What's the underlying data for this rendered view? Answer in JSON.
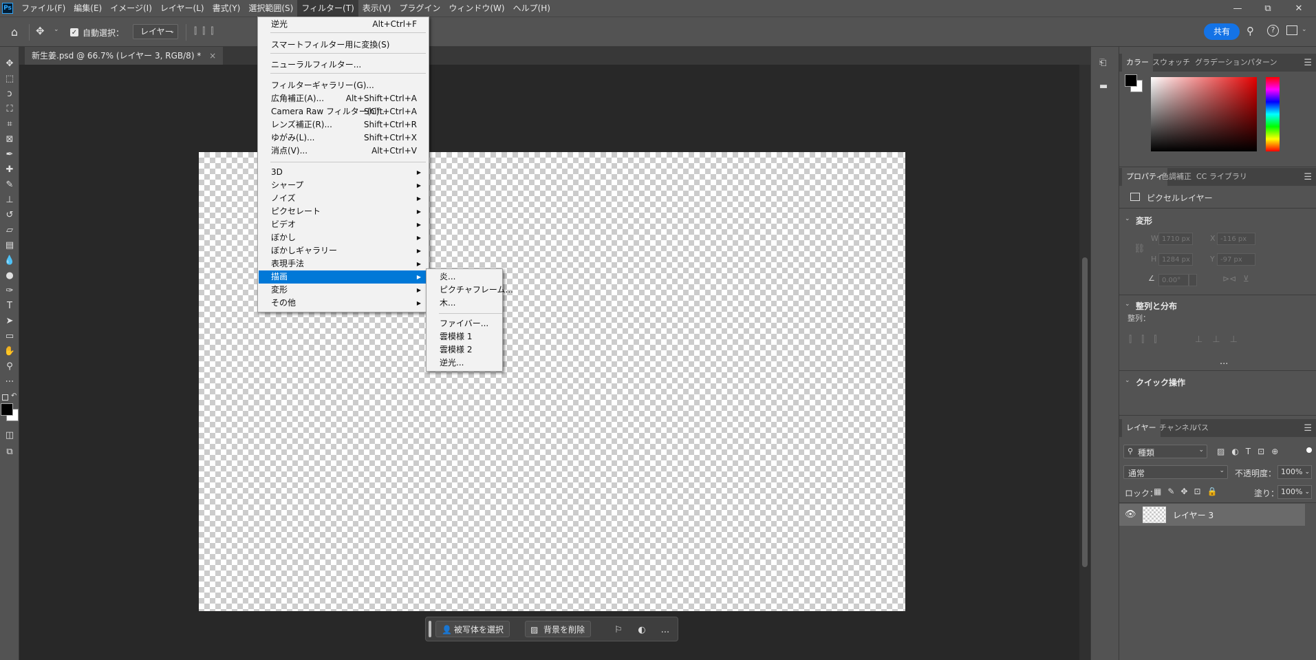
{
  "menubar": {
    "items": [
      "ファイル(F)",
      "編集(E)",
      "イメージ(I)",
      "レイヤー(L)",
      "書式(Y)",
      "選択範囲(S)",
      "フィルター(T)",
      "表示(V)",
      "プラグイン",
      "ウィンドウ(W)",
      "ヘルプ(H)"
    ],
    "active_index": 6,
    "logo": "Ps"
  },
  "window_controls": {
    "minimize": "—",
    "restore": "⧉",
    "close": "✕"
  },
  "options_bar": {
    "auto_select_label": "自動選択：",
    "auto_select_checked": true,
    "target_select": "レイヤー",
    "share_label": "共有"
  },
  "document_tab": {
    "title": "新生姜.psd @ 66.7% (レイヤー 3, RGB/8) *",
    "close": "×"
  },
  "filter_menu": [
    {
      "label": "逆光",
      "shortcut": "Alt+Ctrl+F"
    },
    {
      "label": "スマートフィルター用に変換(S)",
      "shortcut": ""
    },
    {
      "label": "ニューラルフィルター...",
      "shortcut": ""
    },
    {
      "label": "フィルターギャラリー(G)...",
      "shortcut": ""
    },
    {
      "label": "広角補正(A)...",
      "shortcut": "Alt+Shift+Ctrl+A"
    },
    {
      "label": "Camera Raw フィルター(C)...",
      "shortcut": "Shift+Ctrl+A"
    },
    {
      "label": "レンズ補正(R)...",
      "shortcut": "Shift+Ctrl+R"
    },
    {
      "label": "ゆがみ(L)...",
      "shortcut": "Shift+Ctrl+X"
    },
    {
      "label": "消点(V)...",
      "shortcut": "Alt+Ctrl+V"
    },
    {
      "label": "3D",
      "shortcut": ""
    },
    {
      "label": "シャープ",
      "shortcut": ""
    },
    {
      "label": "ノイズ",
      "shortcut": ""
    },
    {
      "label": "ピクセレート",
      "shortcut": ""
    },
    {
      "label": "ビデオ",
      "shortcut": ""
    },
    {
      "label": "ぼかし",
      "shortcut": ""
    },
    {
      "label": "ぼかしギャラリー",
      "shortcut": ""
    },
    {
      "label": "表現手法",
      "shortcut": ""
    },
    {
      "label": "描画",
      "shortcut": ""
    },
    {
      "label": "変形",
      "shortcut": ""
    },
    {
      "label": "その他",
      "shortcut": ""
    }
  ],
  "render_submenu": [
    "炎...",
    "ピクチャフレーム...",
    "木...",
    "ファイバー...",
    "雲模様 1",
    "雲模様 2",
    "逆光..."
  ],
  "taskbar": {
    "select_subject": "被写体を選択",
    "remove_bg": "背景を削除",
    "more": "..."
  },
  "color_panel": {
    "tabs": [
      "カラー",
      "スウォッチ",
      "グラデーション",
      "パターン"
    ],
    "active": 0,
    "foreground": "#000000",
    "background": "#ffffff"
  },
  "properties_panel": {
    "tabs": [
      "プロパティ",
      "色調補正",
      "CC ライブラリ"
    ],
    "active": 0,
    "layer_type": "ピクセルレイヤー",
    "transform_title": "変形",
    "w_label": "W",
    "w_value": "1710 px",
    "x_label": "X",
    "x_value": "-116 px",
    "h_label": "H",
    "h_value": "1284 px",
    "y_label": "Y",
    "y_value": "-97 px",
    "angle_value": "0.00°",
    "align_title": "整列と分布",
    "align_label": "整列：",
    "more": "...",
    "quick_title": "クイック操作"
  },
  "layers_panel": {
    "tabs": [
      "レイヤー",
      "チャンネル",
      "パス"
    ],
    "active": 0,
    "filter_kind": "種類",
    "blend_mode": "通常",
    "opacity_label": "不透明度：",
    "opacity_value": "100%",
    "lock_label": "ロック：",
    "fill_label": "塗り：",
    "fill_value": "100%",
    "layers": [
      {
        "name": "レイヤー 3",
        "visible": true
      }
    ]
  }
}
